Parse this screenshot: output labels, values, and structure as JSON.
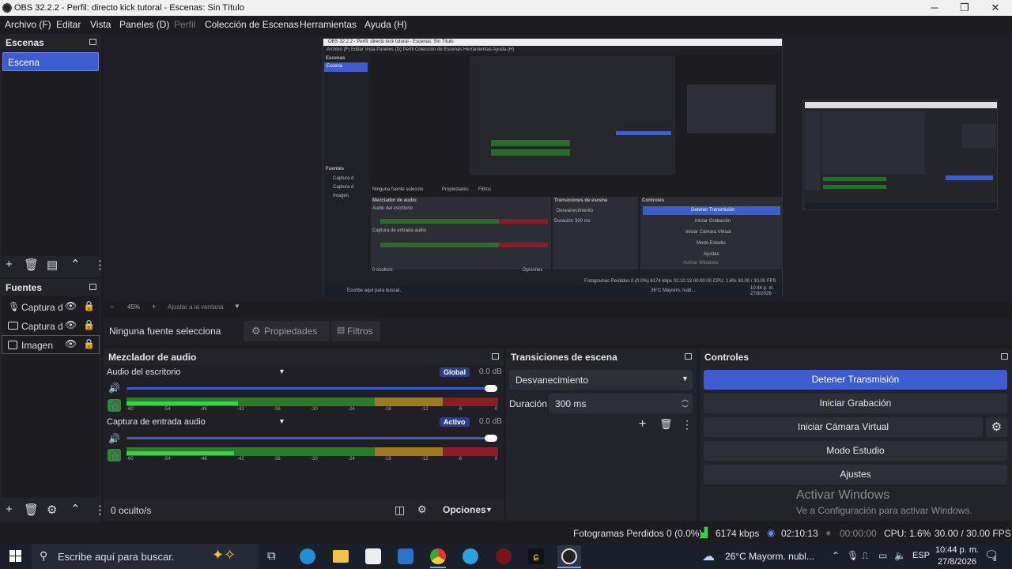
{
  "window": {
    "title": "OBS 32.2.2 - Perfil: directo kick tutoral - Escenas: Sin Título",
    "minimize": "─",
    "maximize": "❐",
    "close": "✕"
  },
  "menu": {
    "items": [
      "Archivo (F)",
      "Editar",
      "Vista",
      "Paneles (D)",
      "Perfil",
      "Colección de Escenas",
      "Herramientas",
      "Ayuda (H)"
    ]
  },
  "scenes": {
    "title": "Escenas",
    "items": [
      "Escena"
    ]
  },
  "sources": {
    "title": "Fuentes",
    "items": [
      {
        "label": "Captura d",
        "icon": "microphone-icon"
      },
      {
        "label": "Captura d",
        "icon": "monitor-icon"
      },
      {
        "label": "Imagen",
        "icon": "image-icon"
      }
    ]
  },
  "preview": {
    "zoom": "45%",
    "fit_label": "Ajustar a la ventana",
    "nested": {
      "title": "OBS 32.2.2 - Perfil: directo kick tutoral - Escenas: Sin Título",
      "menu": "Archivo (F)   Editar   Vista   Paneles (D)   Perfil   Colección de Escenas   Herramientas   Ayuda (H)",
      "scenes": "Escenas",
      "scene_item": "Escena",
      "sources": "Fuentes",
      "src1": "Captura d",
      "src2": "Captura d",
      "src3": "Imagen",
      "no_source": "Ninguna fuente seleccio",
      "props": "Propiedades",
      "filters": "Filtros",
      "mixer": "Mezclador de audio",
      "desktop": "Audio del escritorio",
      "mic": "Captura de entrada audio",
      "transitions": "Transiciones de escena",
      "fade": "Desvanecimiento",
      "duration": "Duración",
      "duration_val": "300 ms",
      "controls": "Controles",
      "stop": "Detener Transmisión",
      "record": "Iniciar Grabación",
      "vcam": "Iniciar Cámara Virtual",
      "studio": "Modo Estudio",
      "settings": "Ajustes",
      "activate": "Activar Windows",
      "activate2": "Ve a Configuración para activar Windows.",
      "hidden": "0 oculto/s",
      "options": "Opciones",
      "zoom": "45%",
      "fit": "Ajustar a la ventana",
      "status": "Fotogramas Perdidos 0 (0.0%)   6174 kbps   02:10:13   00:00:00   CPU: 1.6%   30.00 / 30.00 FPS",
      "search": "Escribe aquí para buscar.",
      "weather": "26°C  Mayorm. nubl...",
      "clock": "10:44 p. m.",
      "date": "27/8/2026"
    }
  },
  "source_toolbar": {
    "no_source": "Ninguna fuente selecciona",
    "properties": "Propiedades",
    "filters": "Filtros"
  },
  "mixer": {
    "title": "Mezclador de audio",
    "channels": [
      {
        "name": "Audio del escritorio",
        "badge": "Global",
        "db": "0.0 dB",
        "volume": 1.0,
        "level": 0.3
      },
      {
        "name": "Captura de entrada audio",
        "badge": "Activo",
        "db": "0.0 dB",
        "volume": 1.0,
        "level": 0.29
      }
    ],
    "ticks": [
      "-60",
      "-54",
      "-48",
      "-42",
      "-36",
      "-30",
      "-24",
      "-18",
      "-12",
      "-6",
      "0"
    ],
    "hidden": "0 oculto/s",
    "options": "Opciones"
  },
  "transitions": {
    "title": "Transiciones de escena",
    "selected": "Desvanecimiento",
    "duration_label": "Duración",
    "duration_value": "300 ms"
  },
  "controls": {
    "title": "Controles",
    "stop_stream": "Detener Transmisión",
    "start_record": "Iniciar Grabación",
    "start_vcam": "Iniciar Cámara Virtual",
    "studio_mode": "Modo Estudio",
    "settings": "Ajustes",
    "activate_title": "Activar Windows",
    "activate_sub": "Ve a Configuración para activar Windows."
  },
  "status": {
    "dropped": "Fotogramas Perdidos 0 (0.0%)",
    "bitrate": "6174 kbps",
    "stream_time": "02:10:13",
    "record_time": "00:00:00",
    "cpu": "CPU: 1.6%",
    "fps": "30.00 / 30.00 FPS"
  },
  "taskbar": {
    "search_placeholder": "Escribe aquí para buscar.",
    "weather": "26°C  Mayorm. nubl...",
    "lang": "ESP",
    "time": "10:44 p. m.",
    "date": "27/8/2026",
    "notif_count": "3"
  },
  "colors": {
    "accent": "#3c5ccf",
    "meter_green": "#2fbf3c",
    "meter_yellow": "#9c8a22",
    "meter_red": "#8a1e28"
  }
}
